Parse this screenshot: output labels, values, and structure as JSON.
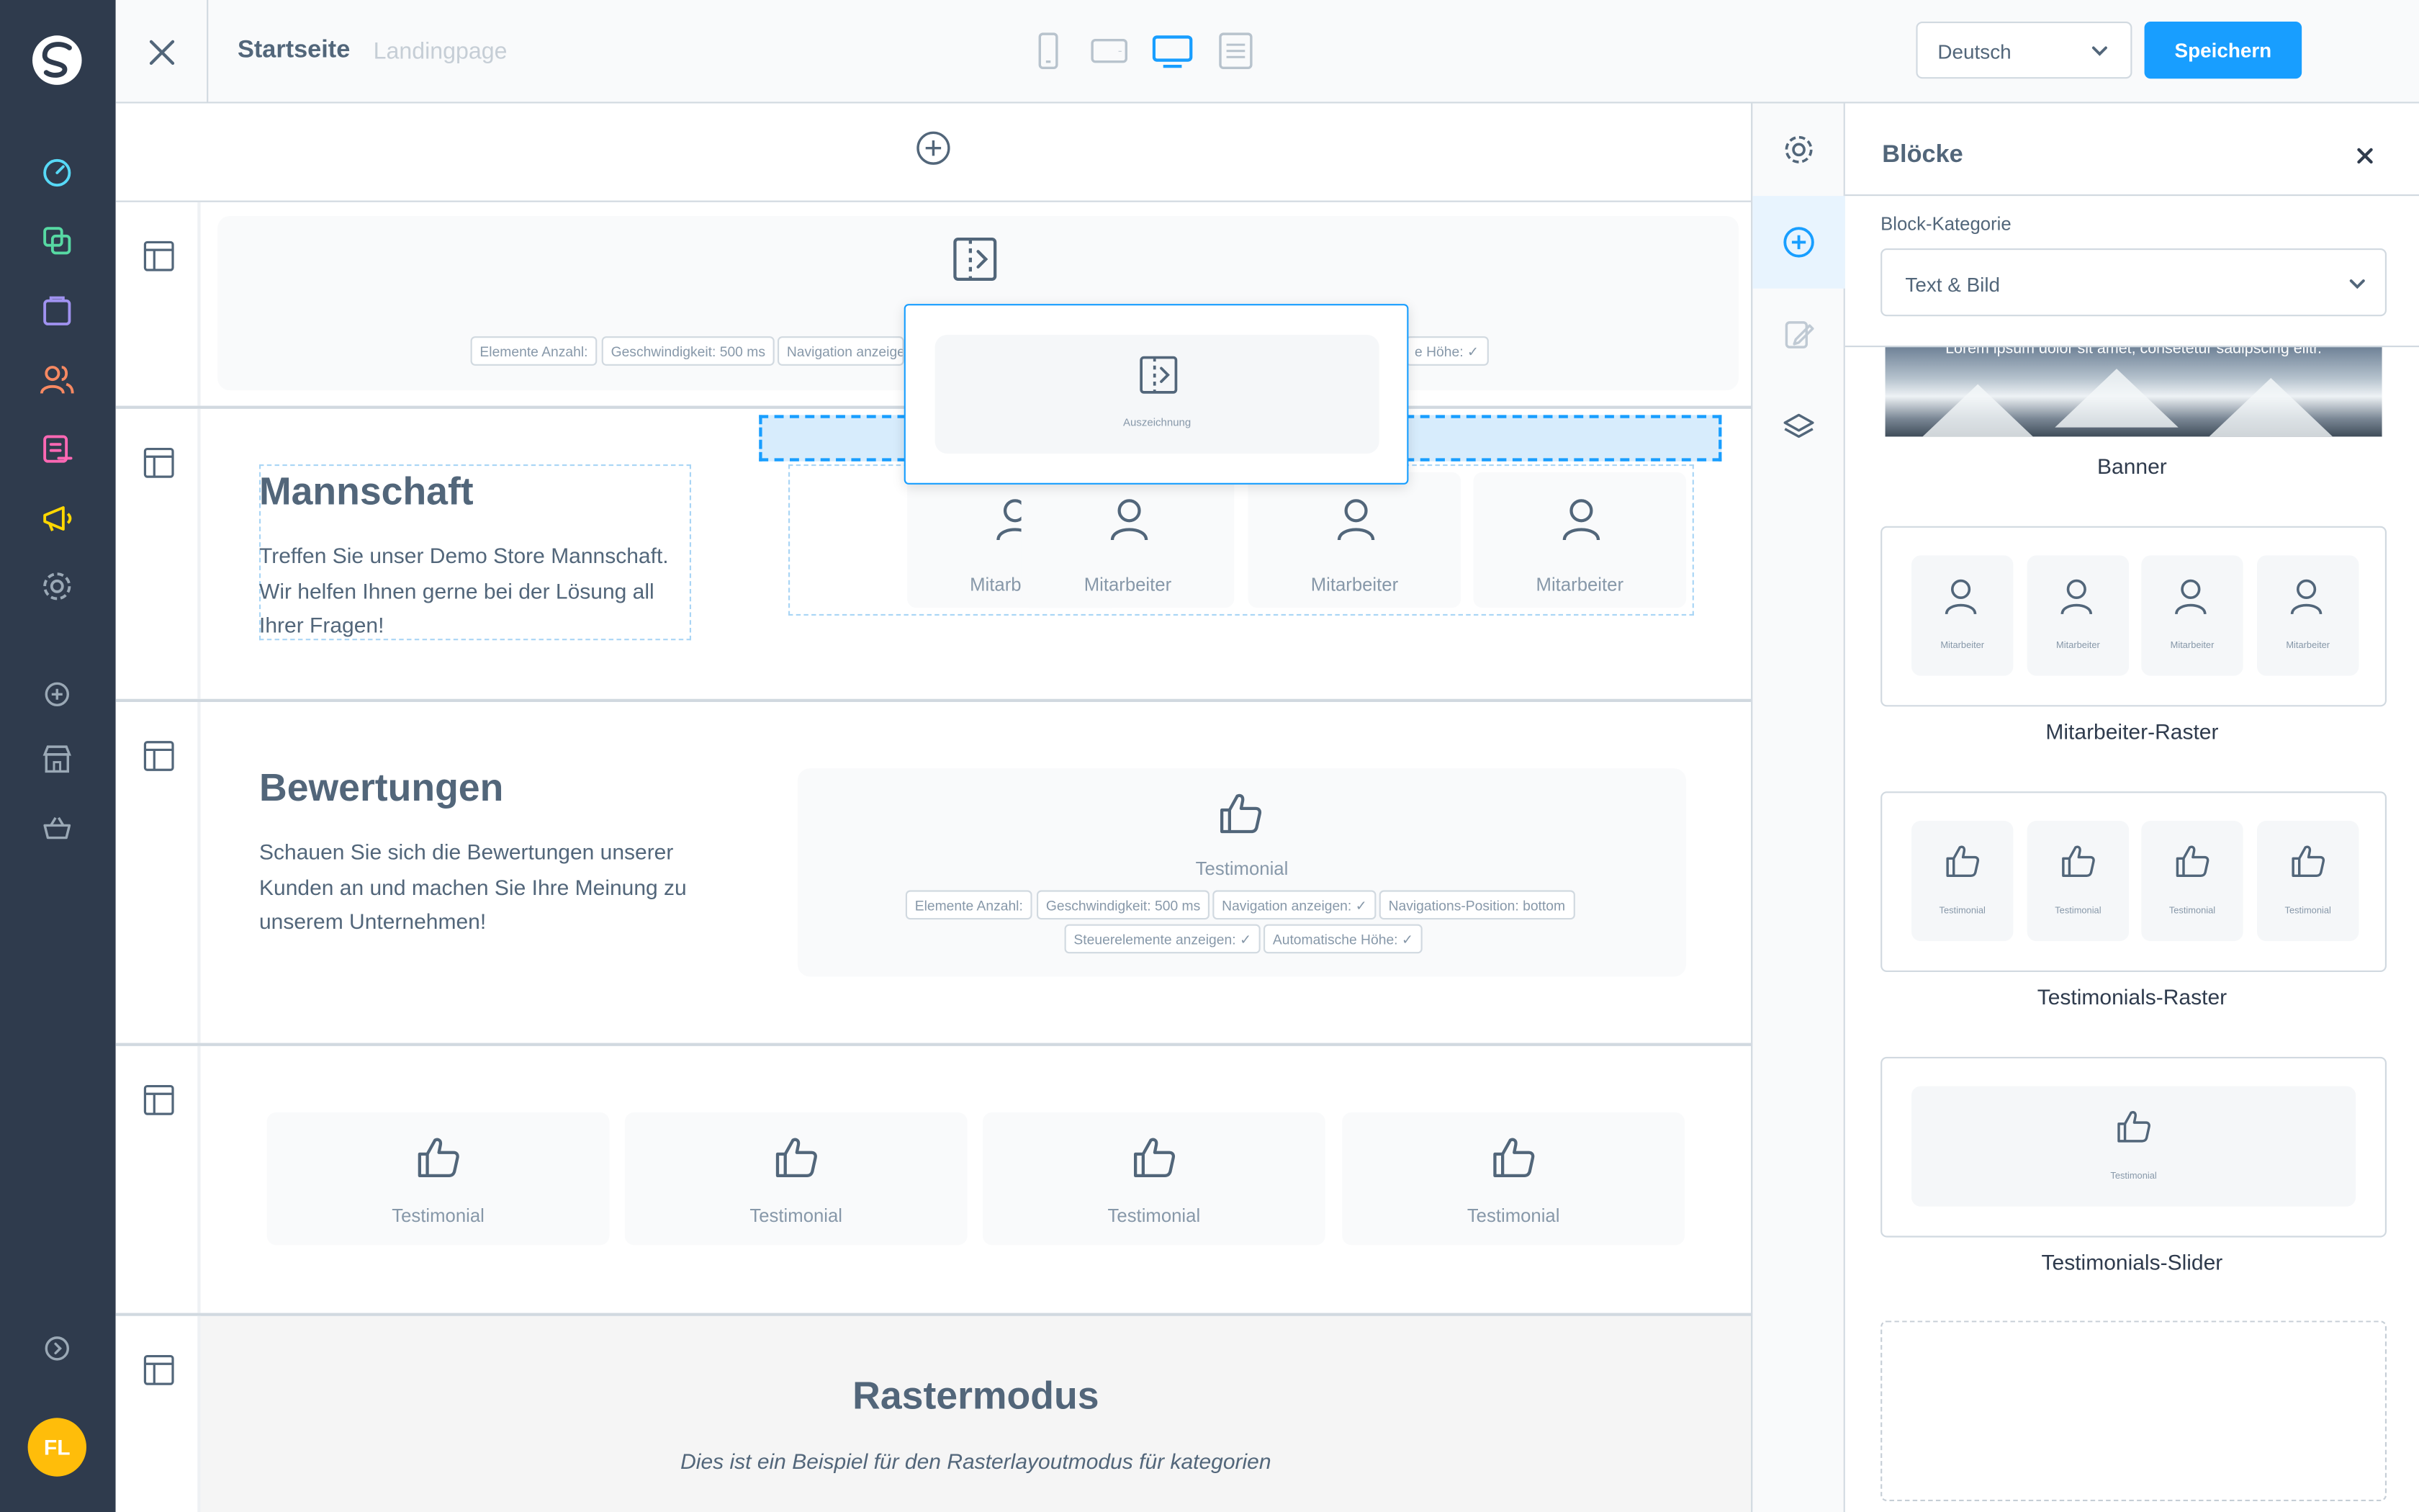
{
  "topbar": {
    "title": "Startseite",
    "subtitle": "Landingpage",
    "language": "Deutsch",
    "save_label": "Speichern"
  },
  "user": {
    "initials": "FL"
  },
  "colors": {
    "sidebar": "#2f3b4d",
    "accent": "#189eff",
    "avatar": "#ffbd0a",
    "nav_dashboard": "#57d9f7",
    "nav_catalog": "#57d9a3",
    "nav_orders": "#a092f0",
    "nav_customers": "#f88962",
    "nav_content": "#ff68b4",
    "nav_marketing": "#ffd700"
  },
  "canvas": {
    "slider_chips": [
      "Elemente Anzahl:",
      "Geschwindigkeit: 500 ms",
      "Navigation anzeige",
      "e Höhe: ✓"
    ],
    "drag_preview_label": "Auszeichnung",
    "team": {
      "title": "Mannschaft",
      "text": "Treffen Sie unser Demo Store Mannschaft. Wir helfen Ihnen gerne bei der Lösung all Ihrer Fragen!",
      "employees": [
        "Mitarbeiter",
        "Mitarbeiter",
        "Mitarbeiter",
        "Mitarbeiter"
      ]
    },
    "reviews": {
      "title": "Bewertungen",
      "text": "Schauen Sie sich die Bewertungen unserer Kunden an und machen Sie Ihre Meinung zu unserem Unternehmen!",
      "block_label": "Testimonial",
      "chips_row1": [
        "Elemente Anzahl:",
        "Geschwindigkeit: 500 ms",
        "Navigation anzeigen: ✓",
        "Navigations-Position: bottom"
      ],
      "chips_row2": [
        "Steuerelemente anzeigen: ✓",
        "Automatische Höhe: ✓"
      ]
    },
    "testimonials": [
      "Testimonial",
      "Testimonial",
      "Testimonial",
      "Testimonial"
    ],
    "grid_mode": {
      "title": "Rastermodus",
      "text": "Dies ist ein Beispiel für den Rasterlayoutmodus für kategorien"
    }
  },
  "panel": {
    "title": "Blöcke",
    "category_label": "Block-Kategorie",
    "category_value": "Text & Bild",
    "banner_overlay_text": "Lorem ipsum dolor sit amet, consetetur sadipscing elitr.",
    "blocks": [
      {
        "label": "Banner"
      },
      {
        "label": "Mitarbeiter-Raster",
        "items": [
          "Mitarbeiter",
          "Mitarbeiter",
          "Mitarbeiter",
          "Mitarbeiter"
        ]
      },
      {
        "label": "Testimonials-Raster",
        "items": [
          "Testimonial",
          "Testimonial",
          "Testimonial",
          "Testimonial"
        ]
      },
      {
        "label": "Testimonials-Slider",
        "items": [
          "Testimonial"
        ]
      }
    ]
  }
}
